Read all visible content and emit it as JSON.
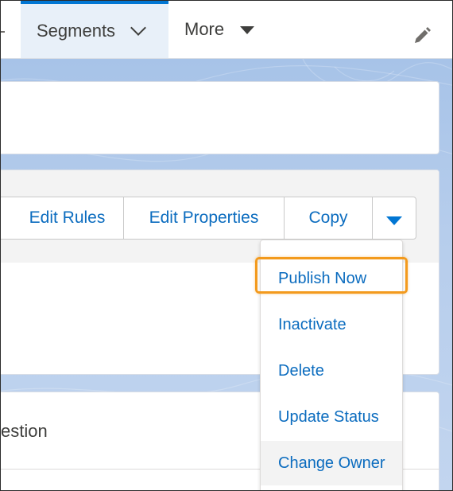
{
  "nav": {
    "tabs": [
      {
        "label": "Segments",
        "active": true
      },
      {
        "label": "More",
        "active": false
      }
    ]
  },
  "record_actions": {
    "buttons": [
      "Edit Rules",
      "Edit Properties",
      "Copy"
    ]
  },
  "menu": {
    "items": [
      "Publish Now",
      "Inactivate",
      "Delete",
      "Update Status",
      "Change Owner"
    ],
    "highlighted": "Publish Now"
  },
  "related": {
    "partial_text": "estion"
  },
  "colors": {
    "brand": "#0176d3",
    "link": "#0b6cbf",
    "highlight": "#f39a1d",
    "background": "#b6cdec"
  },
  "icons": [
    "chevron-down-icon",
    "caret-down-icon",
    "pencil-icon"
  ]
}
